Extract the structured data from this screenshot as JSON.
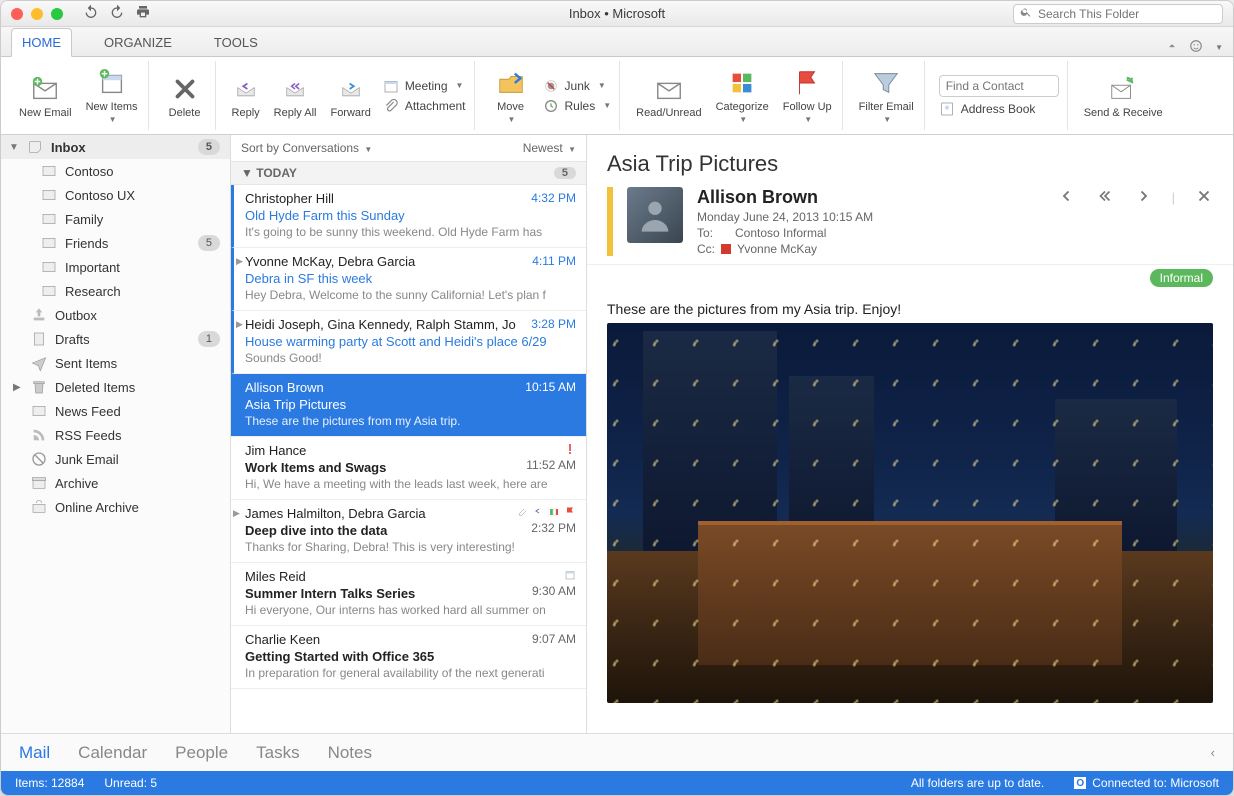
{
  "titlebar": {
    "title": "Inbox • Microsoft",
    "search_placeholder": "Search This Folder"
  },
  "tabs": {
    "home": "HOME",
    "organize": "ORGANIZE",
    "tools": "TOOLS"
  },
  "ribbon": {
    "new_email": "New Email",
    "new_items": "New Items",
    "delete": "Delete",
    "reply": "Reply",
    "reply_all": "Reply All",
    "forward": "Forward",
    "meeting": "Meeting",
    "attachment": "Attachment",
    "move": "Move",
    "junk": "Junk",
    "rules": "Rules",
    "read_unread": "Read/Unread",
    "categorize": "Categorize",
    "follow_up": "Follow Up",
    "filter_email": "Filter Email",
    "find_contact_placeholder": "Find a Contact",
    "address_book": "Address Book",
    "send_receive": "Send & Receive"
  },
  "folders": {
    "inbox": {
      "label": "Inbox",
      "count": "5"
    },
    "subs": [
      {
        "label": "Contoso"
      },
      {
        "label": "Contoso UX"
      },
      {
        "label": "Family"
      },
      {
        "label": "Friends",
        "count": "5"
      },
      {
        "label": "Important"
      },
      {
        "label": "Research"
      }
    ],
    "others": [
      {
        "label": "Outbox",
        "icon": "outbox"
      },
      {
        "label": "Drafts",
        "icon": "drafts",
        "count": "1"
      },
      {
        "label": "Sent Items",
        "icon": "sent"
      },
      {
        "label": "Deleted Items",
        "icon": "trash",
        "exp": true
      },
      {
        "label": "News Feed",
        "icon": "news"
      },
      {
        "label": "RSS Feeds",
        "icon": "rss"
      },
      {
        "label": "Junk Email",
        "icon": "junk"
      },
      {
        "label": "Archive",
        "icon": "archive"
      },
      {
        "label": "Online Archive",
        "icon": "online"
      }
    ]
  },
  "listheader": {
    "sort": "Sort by Conversations",
    "order": "Newest"
  },
  "group": {
    "label": "TODAY",
    "count": "5"
  },
  "messages": [
    {
      "from": "Christopher Hill",
      "subject": "Old Hyde Farm this Sunday",
      "preview": "It's going to be sunny this weekend. Old Hyde Farm has",
      "time": "4:32 PM",
      "unread": true
    },
    {
      "from": "Yvonne McKay, Debra Garcia",
      "subject": "Debra in SF this week",
      "preview": "Hey Debra, Welcome to the sunny California! Let's plan f",
      "time": "4:11 PM",
      "unread": true,
      "thread": true
    },
    {
      "from": "Heidi Joseph, Gina Kennedy, Ralph Stamm, Jo",
      "subject": "House warming party at Scott and Heidi's place 6/29",
      "preview": "Sounds Good!",
      "time": "3:28 PM",
      "unread": true,
      "thread": true
    },
    {
      "from": "Allison Brown",
      "subject": "Asia Trip Pictures",
      "preview": "These are the pictures from my Asia trip.",
      "time": "10:15 AM",
      "selected": true
    },
    {
      "from": "Jim Hance",
      "subject": "Work Items and Swags",
      "preview": "Hi, We have a meeting with the leads last week, here are",
      "time": "11:52 AM",
      "read": true,
      "high": true
    },
    {
      "from": "James Halmilton, Debra Garcia",
      "subject": "Deep dive into the data",
      "preview": "Thanks for Sharing, Debra! This is very interesting!",
      "time": "2:32 PM",
      "read": true,
      "thread": true,
      "flags": true
    },
    {
      "from": "Miles Reid",
      "subject": "Summer Intern Talks Series",
      "preview": "Hi everyone, Our interns has worked hard all summer on",
      "time": "9:30 AM",
      "read": true,
      "cal": true
    },
    {
      "from": "Charlie Keen",
      "subject": "Getting Started with Office 365",
      "preview": "In preparation for general availability of the next generati",
      "time": "9:07 AM",
      "read": true
    }
  ],
  "reading": {
    "title": "Asia Trip Pictures",
    "sender": "Allison Brown",
    "date": "Monday June 24, 2013 10:15 AM",
    "to_label": "To:",
    "to_value": "Contoso Informal",
    "cc_label": "Cc:",
    "cc_value": "Yvonne McKay",
    "category": "Informal",
    "body": "These are the pictures from my Asia trip.   Enjoy!"
  },
  "nav": {
    "mail": "Mail",
    "calendar": "Calendar",
    "people": "People",
    "tasks": "Tasks",
    "notes": "Notes"
  },
  "status": {
    "items": "Items: 12884",
    "unread": "Unread: 5",
    "sync": "All folders are up to date.",
    "conn": "Connected to: Microsoft"
  },
  "colors": {
    "cat_to": "#bdbdbd",
    "cat_cc": "#d23a2e"
  }
}
